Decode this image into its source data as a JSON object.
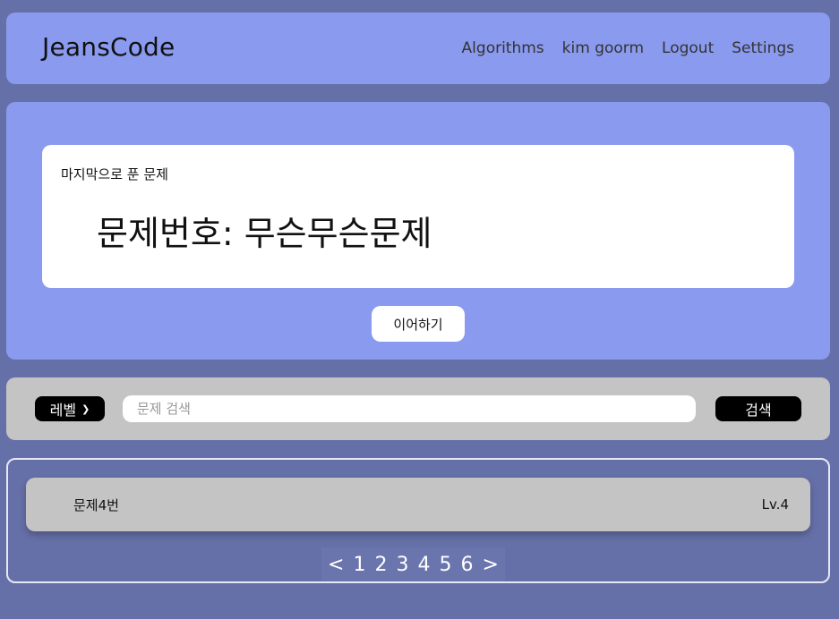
{
  "header": {
    "logo": "JeansCode",
    "nav": [
      "Algorithms",
      "kim goorm",
      "Logout",
      "Settings"
    ]
  },
  "last_solved": {
    "label": "마지막으로 푼 문제",
    "title": "문제번호: 무슨무슨문제",
    "continue_label": "이어하기"
  },
  "search": {
    "level_select": "레벨",
    "placeholder": "문제 검색",
    "button_label": "검색"
  },
  "problems": [
    {
      "title": "문제4번",
      "level": "Lv.4"
    }
  ],
  "pagination": {
    "prev": "<",
    "pages": [
      "1",
      "2",
      "3",
      "4",
      "5",
      "6"
    ],
    "next": ">"
  }
}
